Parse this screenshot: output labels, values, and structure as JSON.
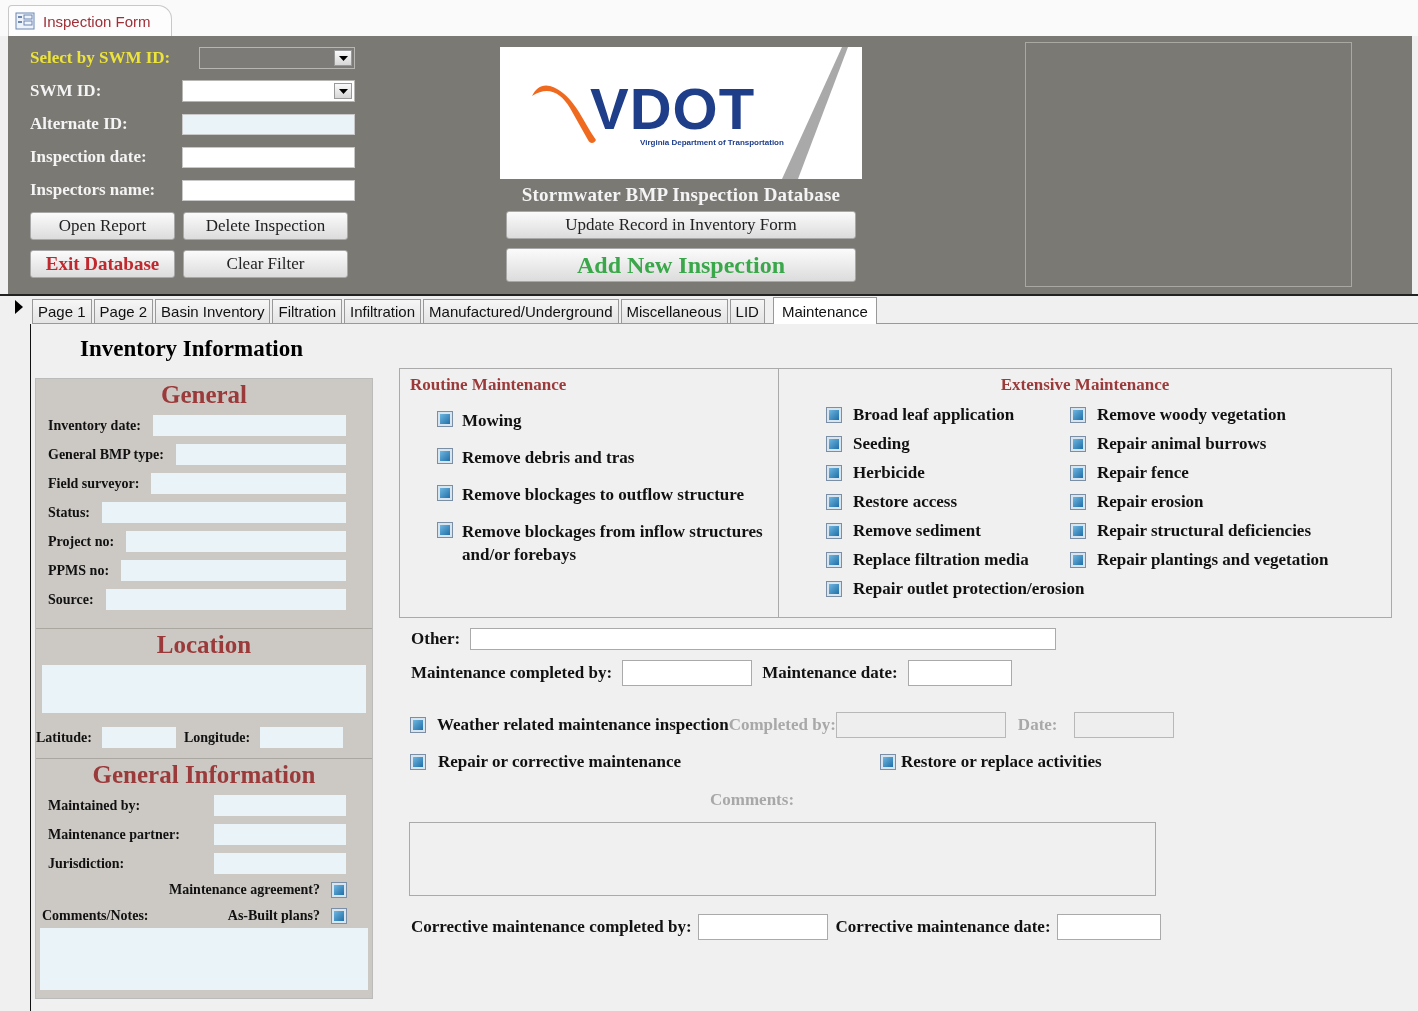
{
  "document_tab": {
    "title": "Inspection Form"
  },
  "header": {
    "select": {
      "label": "Select by SWM ID:"
    },
    "fields": [
      {
        "label": "SWM ID:",
        "kind": "combo"
      },
      {
        "label": "Alternate ID:",
        "kind": "readonly"
      },
      {
        "label": "Inspection date:",
        "kind": "text"
      },
      {
        "label": "Inspectors name:",
        "kind": "text"
      }
    ],
    "buttons": [
      {
        "label": "Open Report",
        "kind": "normal"
      },
      {
        "label": "Delete Inspection",
        "kind": "normal"
      },
      {
        "label": "Exit Database",
        "kind": "danger"
      },
      {
        "label": "Clear Filter",
        "kind": "normal"
      }
    ],
    "logo": {
      "wordmark": "VDOT",
      "tagline": "Virginia Department of Transportation"
    },
    "title": "Stormwater BMP Inspection Database",
    "actions": [
      {
        "label": "Update Record in Inventory Form",
        "kind": "normal"
      },
      {
        "label": "Add New Inspection",
        "kind": "primary"
      }
    ]
  },
  "tabs": [
    {
      "label": "Page 1",
      "selected": false
    },
    {
      "label": "Page 2",
      "selected": false
    },
    {
      "label": "Basin Inventory",
      "selected": false
    },
    {
      "label": "Filtration",
      "selected": false
    },
    {
      "label": "Infiltration",
      "selected": false
    },
    {
      "label": "Manufactured/Underground",
      "selected": false
    },
    {
      "label": "Miscellaneous",
      "selected": false
    },
    {
      "label": "LID",
      "selected": false
    },
    {
      "label": "Maintenance",
      "selected": true
    }
  ],
  "inventory": {
    "title": "Inventory Information",
    "general": {
      "title": "General",
      "fields": [
        "Inventory date:",
        "General BMP type:",
        "Field surveyor:",
        "Status:",
        "Project no:",
        "PPMS no:",
        "Source:"
      ]
    },
    "location": {
      "title": "Location",
      "latitude": "Latitude:",
      "longitude": "Longitude:"
    },
    "general_information": {
      "title": "General Information",
      "fields": [
        "Maintained by:",
        "Maintenance partner:",
        "Jurisdiction:"
      ],
      "maintenance_agreement": {
        "label": "Maintenance agreement?",
        "checked": false
      },
      "comments_label": "Comments/Notes:",
      "as_built": {
        "label": "As-Built plans?",
        "checked": false
      }
    }
  },
  "routine": {
    "title": "Routine Maintenance",
    "items": [
      {
        "label": "Mowing",
        "checked": false
      },
      {
        "label": "Remove debris and tras",
        "checked": false
      },
      {
        "label": "Remove blockages to outflow structure",
        "checked": false
      },
      {
        "label": "Remove blockages from inflow structures and/or forebays",
        "checked": false
      }
    ]
  },
  "extensive": {
    "title": "Extensive Maintenance",
    "items": [
      {
        "label": "Broad leaf application",
        "checked": false
      },
      {
        "label": "Remove woody vegetation",
        "checked": false
      },
      {
        "label": "Seeding",
        "checked": false
      },
      {
        "label": "Repair animal burrows",
        "checked": false
      },
      {
        "label": "Herbicide",
        "checked": false
      },
      {
        "label": "Repair fence",
        "checked": false
      },
      {
        "label": "Restore access",
        "checked": false
      },
      {
        "label": "Repair erosion",
        "checked": false
      },
      {
        "label": "Remove sediment",
        "checked": false
      },
      {
        "label": "Repair structural deficiencies",
        "checked": false
      },
      {
        "label": "Replace filtration media",
        "checked": false
      },
      {
        "label": "Repair plantings and vegetation",
        "checked": false
      },
      {
        "label": "Repair outlet protection/erosion",
        "checked": false
      }
    ]
  },
  "other": {
    "label": "Other:"
  },
  "completion": [
    {
      "label": "Maintenance completed by:"
    },
    {
      "label": "Maintenance date:"
    }
  ],
  "weather": {
    "label": "Weather related maintenance inspection",
    "checked": false,
    "completed_by": {
      "label": "Completed by:",
      "disabled": true
    },
    "date": {
      "label": "Date:",
      "disabled": true
    }
  },
  "repair": {
    "label": "Repair or corrective maintenance",
    "checked": false
  },
  "restore": {
    "label": "Restore or replace activities",
    "checked": false
  },
  "comments": {
    "label": "Comments:",
    "disabled": true
  },
  "corrective": [
    {
      "label": "Corrective maintenance completed by:"
    },
    {
      "label": "Corrective maintenance date:"
    }
  ]
}
